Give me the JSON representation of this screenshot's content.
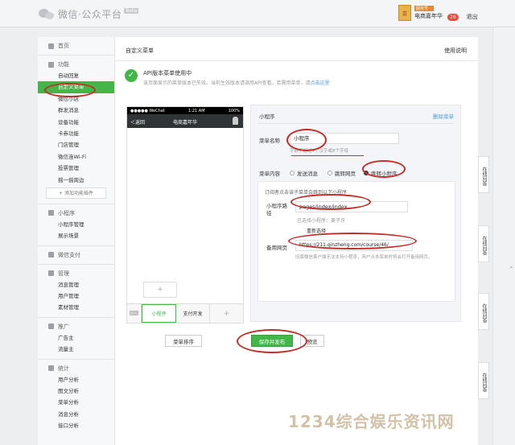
{
  "header": {
    "logo_text": "微信·公众平台",
    "beta": "Beta",
    "account_tag": "服务号",
    "account_name": "电商嘉年华",
    "unread_count": "26",
    "logout": "退出"
  },
  "sidebar": {
    "home": "首页",
    "sections": [
      {
        "title": "功能",
        "items": [
          "自动回复",
          "自定义菜单",
          "微信小店",
          "群发消息",
          "设备功能",
          "卡券功能",
          "门店管理",
          "微信连Wi-Fi",
          "投票管理",
          "摇一摇周边"
        ]
      },
      {
        "title": "小程序",
        "items": [
          "小程序管理",
          "展示场景"
        ]
      },
      {
        "title": "微信支付",
        "items": []
      },
      {
        "title": "管理",
        "items": [
          "消息管理",
          "用户管理",
          "素材管理"
        ]
      },
      {
        "title": "推广",
        "items": [
          "广告主",
          "流量主"
        ]
      },
      {
        "title": "统计",
        "items": [
          "用户分析",
          "图文分析",
          "菜单分析",
          "消息分析",
          "接口分析"
        ]
      }
    ],
    "add_plugin": "+ 添加功能插件"
  },
  "main": {
    "title": "自定义菜单",
    "help": "使用说明",
    "notice_title": "API版本菜单使用中",
    "notice_desc": "该页面显示的菜单版本已失效。当前生效版本请调用API查看。若需用菜单，请",
    "notice_link": "点击这里"
  },
  "phone": {
    "carrier": "●●●●● WeChat ",
    "time": "1:21 AM",
    "battery": "100%",
    "back": "＜返回",
    "title": "电商嘉年华",
    "menu_items": [
      "小程序",
      "支付开发"
    ],
    "add_symbol": "+"
  },
  "editor": {
    "title": "小程序",
    "delete": "删除菜单",
    "name_label": "菜单名称",
    "name_value": "小程序",
    "name_tip": "字数不超过4个汉字或8个字母",
    "content_label": "菜单内容",
    "options": [
      "发送消息",
      "跳转网页",
      "跳转小程序"
    ],
    "selected_option": 2,
    "sub_tip": "订阅者点击该子菜单会跳到以下小程序",
    "path_label": "小程序路径",
    "path_value": "pages/index/index",
    "selected_app": "已选择小程序：姜子牙",
    "reselect": "重新选择",
    "backup_label": "备用网页",
    "backup_value": "https://211.qinzheng.com/course/46/",
    "backup_tip": "旧版微信客户端无法支持小程序，用户点击菜单时将会打开备用网页。"
  },
  "buttons": {
    "sort": "菜单排序",
    "save_publish": "保存并发布",
    "preview": "预览"
  },
  "side_tabs": [
    "在线问答",
    "在线问答",
    "在线问答",
    "在线问答"
  ],
  "watermark": "1234综合娱乐资讯网"
}
